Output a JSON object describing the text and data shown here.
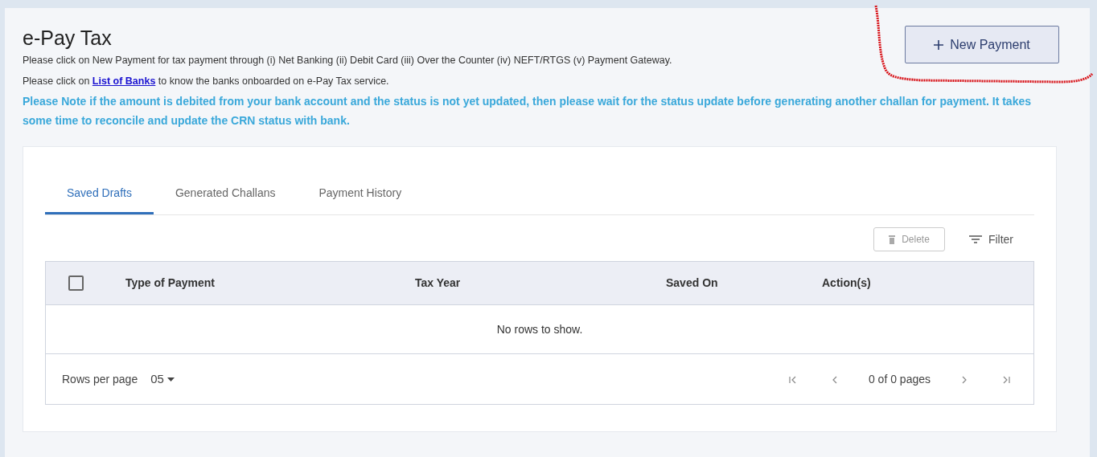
{
  "header": {
    "title": "e-Pay Tax",
    "new_payment_button": "New Payment"
  },
  "intro": [
    "Please click on New Payment for tax payment through (i) Net Banking (ii) Debit Card (iii) Over the Counter (iv) NEFT/RTGS (v) Payment Gateway."
  ],
  "banks_line": {
    "before": "Please click on",
    "link": "List of Banks",
    "after": "to know the banks onboarded on e-Pay Tax service."
  },
  "note": "Please Note if the amount is debited from your bank account and the status is not yet updated, then please wait for the status update before generating another challan for payment. It takes some time to reconcile and update the CRN status with bank.",
  "tabs": [
    {
      "label": "Saved Drafts",
      "selected": true
    },
    {
      "label": "Generated Challans",
      "selected": false
    },
    {
      "label": "Payment History",
      "selected": false
    }
  ],
  "toolbar": {
    "delete": {
      "label": "Delete",
      "disabled": true
    },
    "filter": "Filter"
  },
  "table": {
    "select_all": {
      "checked": false
    },
    "columns": [
      "Type of Payment",
      "Tax Year",
      "Saved On",
      "Action(s)"
    ],
    "empty_message": "No rows to show."
  },
  "pagination": {
    "rows_per_page_label": "Rows per page",
    "rows_per_page": "05",
    "page_info": "0 of 0 pages"
  }
}
